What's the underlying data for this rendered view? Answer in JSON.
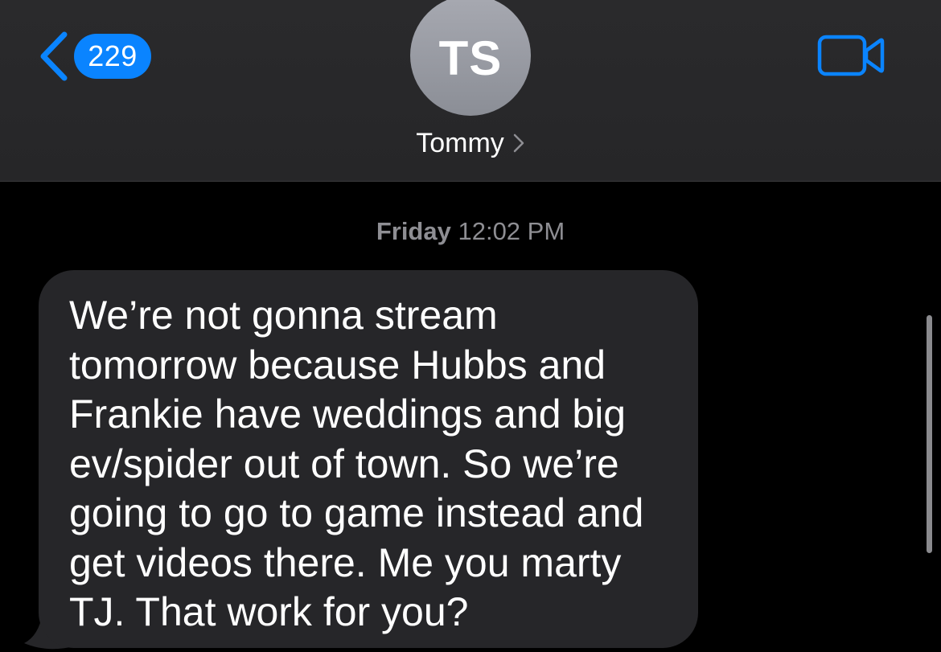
{
  "header": {
    "back_badge_count": "229",
    "avatar_initials": "TS",
    "contact_name": "Tommy"
  },
  "conversation": {
    "timestamp_day": "Friday",
    "timestamp_time": "12:02 PM",
    "messages": [
      {
        "direction": "incoming",
        "text": "We’re not gonna stream\ntomorrow because Hubbs and\nFrankie have weddings and big\nev/spider out of town. So we’re\ngoing to go to game instead and\nget videos there. Me you marty\nTJ. That work for you?"
      }
    ]
  },
  "icons": {
    "back": "chevron-left-icon",
    "contact_detail": "chevron-right-icon",
    "video_call": "video-camera-icon"
  },
  "colors": {
    "accent": "#0a84ff",
    "header_bg": "#2a2a2c",
    "background": "#000000",
    "incoming_bubble": "#262629",
    "timestamp_text": "#8e8e93",
    "avatar_bg": "#9a9ca4"
  }
}
